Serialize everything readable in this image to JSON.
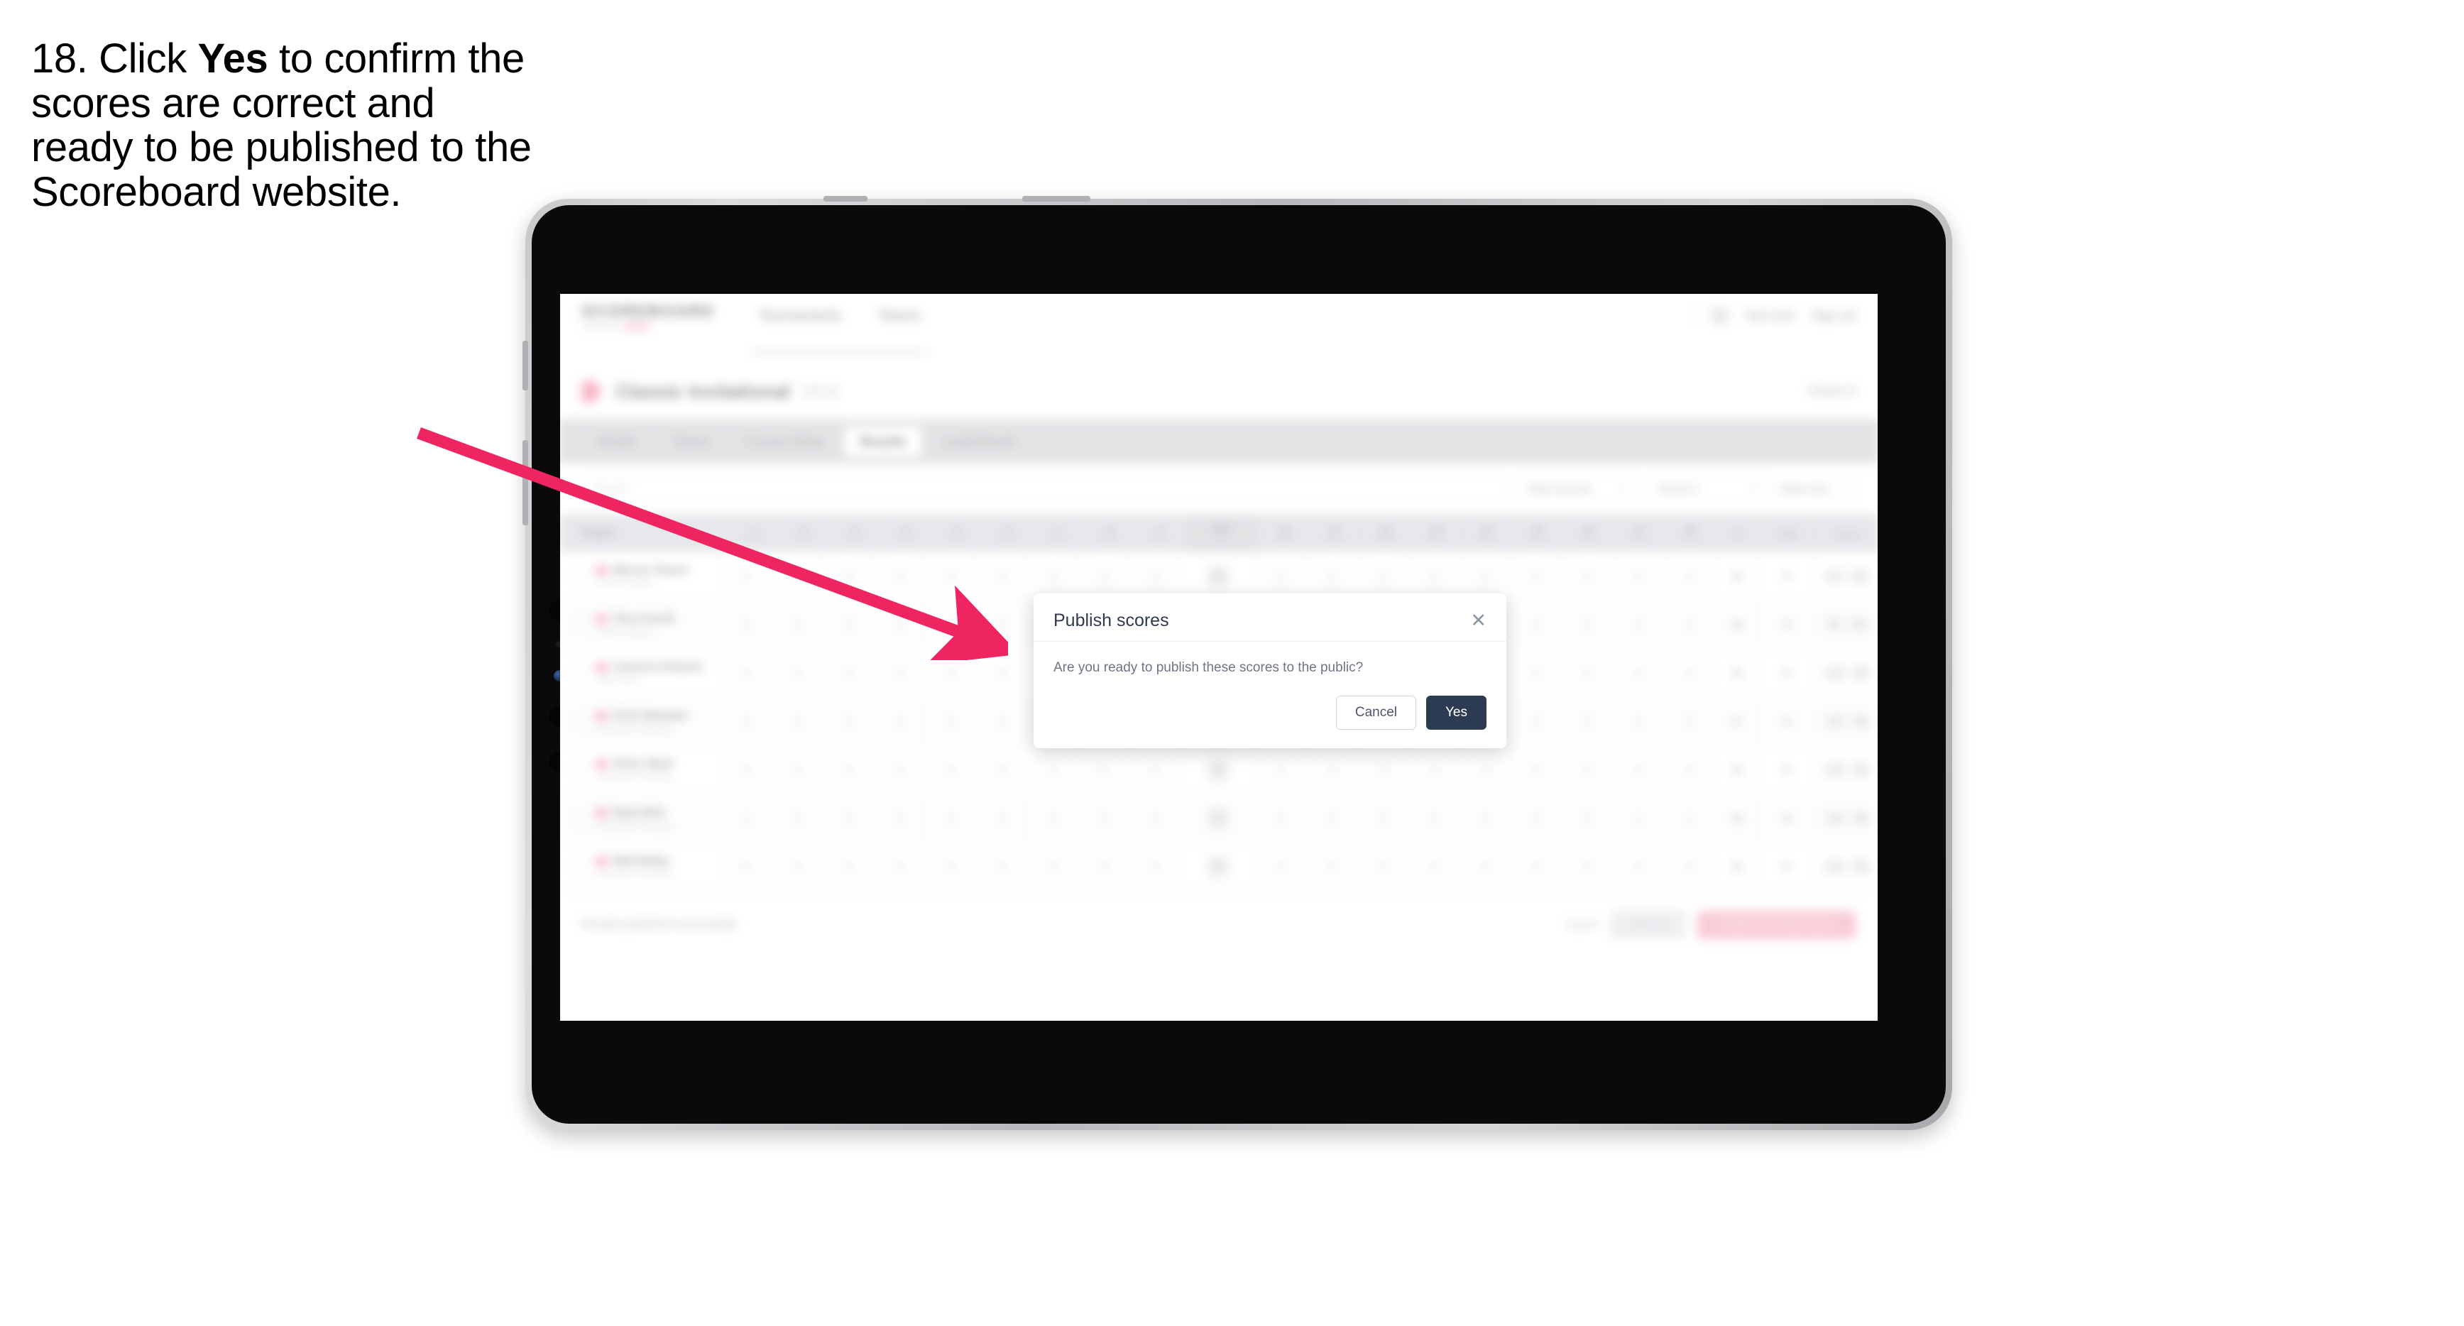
{
  "caption": {
    "prefix": "18. Click ",
    "bold": "Yes",
    "suffix": " to confirm the scores are correct and ready to be published to the Scoreboard website."
  },
  "colors": {
    "arrow": "#ef2561",
    "accent_pink": "#f06292",
    "modal_primary": "#2d3b52",
    "tabbar_bg": "#d3d4d8"
  },
  "app": {
    "brand": {
      "name": "SCOREBOARD",
      "tagline": "Powered by",
      "pill": "Golf"
    },
    "nav": [
      {
        "label": "Tournaments"
      },
      {
        "label": "Teams"
      }
    ],
    "header_right": {
      "avatar": "avatar-icon",
      "user": "Test User",
      "signout": "Sign out"
    },
    "title_row": {
      "badge": "tournament-badge",
      "title": "Classic Invitational",
      "subtitle": "2024",
      "right_link": "Close X"
    },
    "tabs": [
      {
        "label": "Details",
        "active": false
      },
      {
        "label": "Teams",
        "active": false
      },
      {
        "label": "Course Setup",
        "active": false
      },
      {
        "label": "Results",
        "active": true
      },
      {
        "label": "Leaderboard",
        "active": false
      }
    ],
    "filters": {
      "search_placeholder": "Search",
      "selects": [
        {
          "label": "Filter by team",
          "chevron": "chevron-down-icon"
        },
        {
          "label": "Round 1",
          "chevron": "chevron-down-icon"
        }
      ],
      "toggle": {
        "label": "Table view",
        "icon": "grid-icon"
      }
    },
    "table": {
      "player_header": "Player",
      "holes": [
        {
          "n": "1",
          "par": "Par 4"
        },
        {
          "n": "2",
          "par": "Par 4"
        },
        {
          "n": "3",
          "par": "Par 3"
        },
        {
          "n": "4",
          "par": "Par 5"
        },
        {
          "n": "5",
          "par": "Par 4"
        },
        {
          "n": "6",
          "par": "Par 4"
        },
        {
          "n": "7",
          "par": "Par 3"
        },
        {
          "n": "8",
          "par": "Par 5"
        },
        {
          "n": "9",
          "par": "Par 4"
        },
        {
          "n": "OUT",
          "par": "36"
        },
        {
          "n": "10",
          "par": "Par 4"
        },
        {
          "n": "11",
          "par": "Par 3"
        },
        {
          "n": "12",
          "par": "Par 5"
        },
        {
          "n": "13",
          "par": "Par 4"
        },
        {
          "n": "14",
          "par": "Par 4"
        },
        {
          "n": "15",
          "par": "Par 3"
        },
        {
          "n": "16",
          "par": "Par 5"
        },
        {
          "n": "17",
          "par": "Par 4"
        },
        {
          "n": "18",
          "par": "Par 4"
        }
      ],
      "end_headers": [
        {
          "label": "IN",
          "w": "w1"
        },
        {
          "label": "Total",
          "w": "w2"
        },
        {
          "label": "Score",
          "w": "w3"
        }
      ],
      "rows": [
        {
          "flag": "flag-icon",
          "name": "Marcus Tanner",
          "team": "Coast Crusaders",
          "scores": [
            "4",
            "4",
            "3",
            "5",
            "4",
            "4",
            "3",
            "5",
            "4",
            "36",
            "4",
            "3",
            "5",
            "4",
            "4",
            "3",
            "5",
            "4",
            "4"
          ],
          "in": "36",
          "total": "72",
          "score": [
            "-1",
            "71"
          ]
        },
        {
          "flag": "flag-icon",
          "name": "Theo Farrell",
          "team": "Coast Crusaders",
          "scores": [
            "4",
            "4",
            "3",
            "4",
            "4",
            "5",
            "3",
            "5",
            "4",
            "36",
            "4",
            "3",
            "5",
            "4",
            "4",
            "4",
            "5",
            "4",
            "4"
          ],
          "in": "36",
          "total": "73",
          "score": [
            "E",
            "72"
          ]
        },
        {
          "flag": "flag-icon",
          "name": "Cameron Roberts",
          "team": "Valley Vipers",
          "scores": [
            "4",
            "5",
            "3",
            "5",
            "4",
            "4",
            "3",
            "5",
            "4",
            "37",
            "4",
            "3",
            "5",
            "4",
            "4",
            "3",
            "5",
            "4",
            "4"
          ],
          "in": "36",
          "total": "73",
          "score": [
            "+1",
            "73"
          ]
        },
        {
          "flag": "flag-icon",
          "name": "Chris Newman",
          "team": "Southlands Schooling",
          "scores": [
            "4",
            "4",
            "3",
            "4",
            "5",
            "4",
            "3",
            "5",
            "4",
            "36",
            "4",
            "3",
            "5",
            "4",
            "4",
            "3",
            "5",
            "4",
            "5"
          ],
          "in": "37",
          "total": "74",
          "score": [
            "+2",
            "74"
          ]
        },
        {
          "flag": "flag-icon",
          "name": "Oliver Ward",
          "team": "Southlands Schooling",
          "scores": [
            "4",
            "5",
            "4",
            "5",
            "4",
            "4",
            "3",
            "5",
            "4",
            "38",
            "4",
            "3",
            "5",
            "4",
            "5",
            "3",
            "5",
            "4",
            "4"
          ],
          "in": "38",
          "total": "75",
          "score": [
            "+3",
            "75"
          ]
        },
        {
          "flag": "flag-icon",
          "name": "Ryan Britt",
          "team": "Southlands Schooling",
          "scores": [
            "4",
            "5",
            "3",
            "5",
            "4",
            "4",
            "3",
            "5",
            "4",
            "37",
            "4",
            "3",
            "5",
            "4",
            "4",
            "3",
            "5",
            "4",
            "4"
          ],
          "in": "38",
          "total": "76",
          "score": [
            "+4",
            "76"
          ]
        },
        {
          "flag": "flag-icon",
          "name": "Matt Bailey",
          "team": "Southlands Schooling",
          "scores": [
            "5",
            "4",
            "3",
            "5",
            "4",
            "4",
            "3",
            "5",
            "4",
            "37",
            "4",
            "3",
            "5",
            "4",
            "4",
            "3",
            "5",
            "4",
            "4"
          ],
          "in": "38",
          "total": "76",
          "score": [
            "+4",
            "76"
          ]
        }
      ]
    },
    "footer": {
      "note": "Results published successfully",
      "link": "Cancel",
      "btn_secondary": "Save all",
      "btn_primary": "Publish and notify teams"
    }
  },
  "modal": {
    "title": "Publish scores",
    "close_icon": "close-icon",
    "message": "Are you ready to publish these scores to the public?",
    "cancel_label": "Cancel",
    "yes_label": "Yes"
  }
}
